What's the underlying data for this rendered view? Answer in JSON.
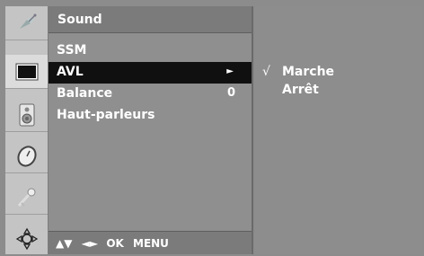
{
  "menu": {
    "title": "Sound",
    "items": [
      {
        "label": "SSM",
        "value": ""
      },
      {
        "label": "AVL",
        "value": "►"
      },
      {
        "label": "Balance",
        "value": "0"
      },
      {
        "label": "Haut-parleurs",
        "value": ""
      }
    ],
    "selected_index": 1
  },
  "footer": {
    "nav_arrows_ud": "▲▼",
    "nav_arrows_lr": "◄►",
    "ok_label": "OK",
    "menu_label": "MENU"
  },
  "options": [
    {
      "label": "Marche",
      "checked": true,
      "check_mark": "√"
    },
    {
      "label": "Arrêt",
      "checked": false,
      "check_mark": ""
    }
  ],
  "icons": [
    "satellite-icon",
    "screen-icon",
    "speaker-icon",
    "clock-icon",
    "key-icon",
    "joystick-icon"
  ],
  "colors": {
    "background": "#8c8c8c",
    "selected_row": "#101010",
    "text": "#ffffff"
  }
}
